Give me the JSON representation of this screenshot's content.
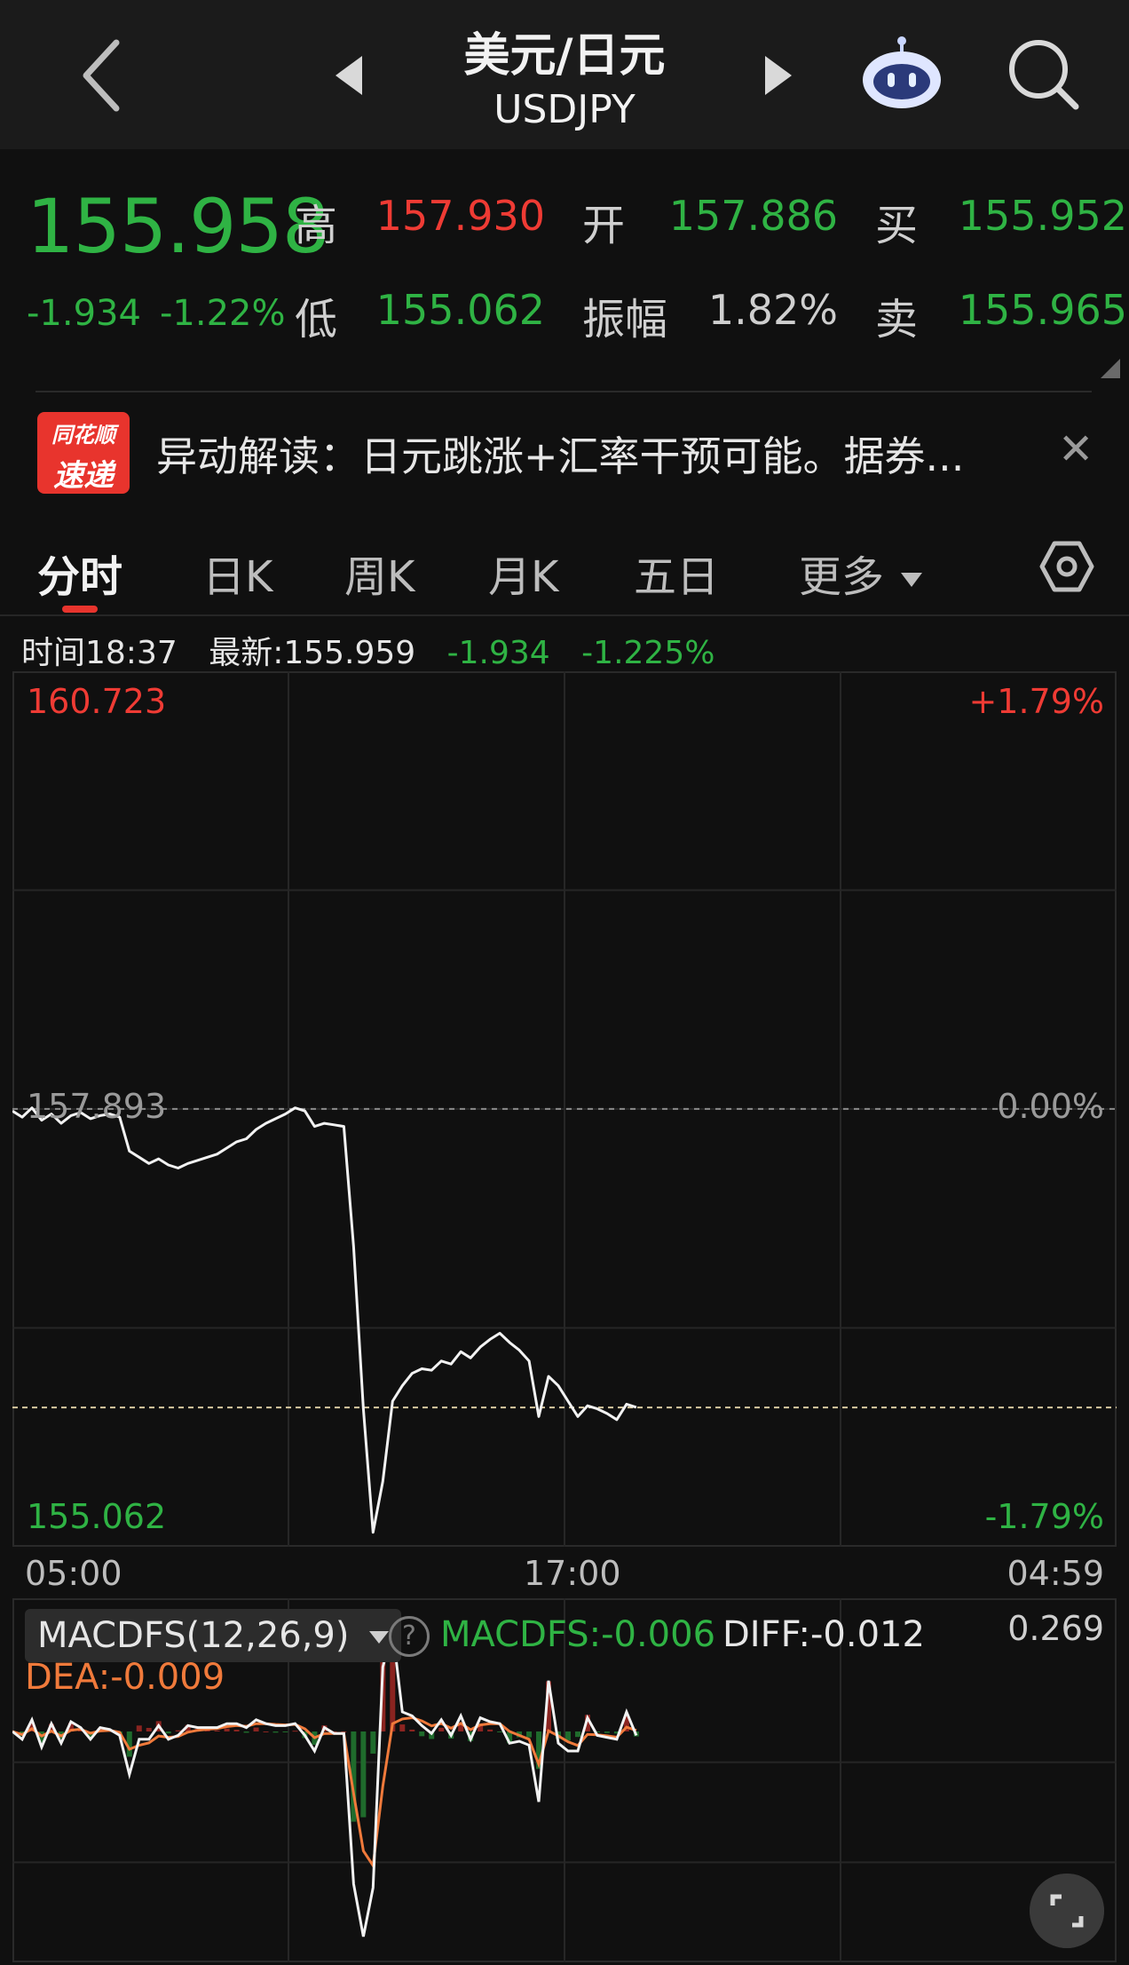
{
  "nav": {
    "title": "美元/日元",
    "subtitle": "USDJPY"
  },
  "quote": {
    "price": "155.958",
    "change": "-1.934",
    "change_pct": "-1.22%",
    "high_label": "高",
    "high": "157.930",
    "open_label": "开",
    "open": "157.886",
    "buy_label": "买",
    "buy": "155.952",
    "low_label": "低",
    "low": "155.062",
    "amplitude_label": "振幅",
    "amplitude": "1.82%",
    "sell_label": "卖",
    "sell": "155.965"
  },
  "news": {
    "logo_line1": "同花顺",
    "logo_line2": "速递",
    "text": "异动解读：日元跳涨+汇率干预可能。据券...",
    "close": "✕"
  },
  "tabs": [
    {
      "label": "分时",
      "active": true
    },
    {
      "label": "日K",
      "active": false
    },
    {
      "label": "周K",
      "active": false
    },
    {
      "label": "月K",
      "active": false
    },
    {
      "label": "五日",
      "active": false
    },
    {
      "label": "更多",
      "active": false
    }
  ],
  "info": {
    "time": "时间18:37",
    "latest": "最新:155.959",
    "change": "-1.934",
    "change_pct": "-1.225%"
  },
  "chart_data": {
    "type": "line",
    "title": "",
    "y_labels": {
      "top": "160.723",
      "top_pct": "+1.79%",
      "mid": "157.893",
      "mid_pct": "0.00%",
      "bottom": "155.062",
      "bottom_pct": "-1.79%"
    },
    "x_labels": [
      "05:00",
      "17:00",
      "04:59"
    ],
    "ylim": [
      155.062,
      160.723
    ],
    "prev_close": 157.893,
    "current": 155.959,
    "series": [
      {
        "values": [
          157.88,
          157.84,
          157.9,
          157.82,
          157.86,
          157.8,
          157.85,
          157.87,
          157.83,
          157.85,
          157.86,
          157.84,
          157.62,
          157.58,
          157.54,
          157.57,
          157.53,
          157.51,
          157.54,
          157.56,
          157.58,
          157.6,
          157.64,
          157.68,
          157.7,
          157.76,
          157.8,
          157.83,
          157.86,
          157.9,
          157.88,
          157.78,
          157.8,
          157.79,
          157.78,
          157.0,
          155.95,
          155.15,
          155.48,
          156.0,
          156.1,
          156.18,
          156.21,
          156.2,
          156.26,
          156.24,
          156.32,
          156.28,
          156.35,
          156.4,
          156.44,
          156.38,
          156.33,
          156.26,
          155.9,
          156.16,
          156.1,
          156.0,
          155.9,
          155.97,
          155.95,
          155.92,
          155.88,
          155.98,
          155.96
        ]
      }
    ]
  },
  "macd": {
    "selector": "MACDFS(12,26,9)",
    "help": "?",
    "macdfs": "MACDFS:-0.006",
    "diff": "DIFF:-0.012",
    "dea": "DEA:-0.009",
    "top_value": "0.269"
  },
  "colors": {
    "up": "#ef3b34",
    "down": "#2fb344",
    "line": "#f2f2f2",
    "dea": "#f07a3b",
    "background": "#101010"
  },
  "icons": {
    "back": "chevron-left-icon",
    "prev": "triangle-left-icon",
    "next": "triangle-right-icon",
    "assistant": "robot-icon",
    "search": "search-icon",
    "settings": "hexagon-settings-icon",
    "expand": "expand-icon"
  }
}
